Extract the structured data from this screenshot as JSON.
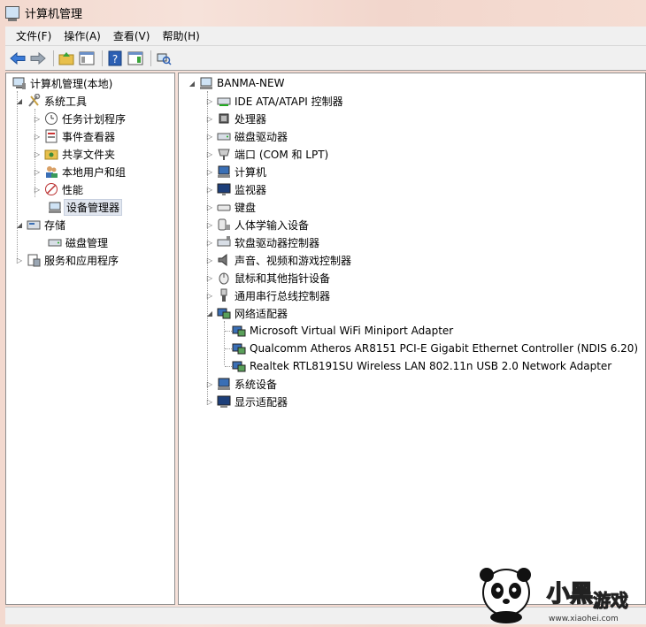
{
  "window": {
    "title": "计算机管理"
  },
  "menu": [
    {
      "label": "文件(F)"
    },
    {
      "label": "操作(A)"
    },
    {
      "label": "查看(V)"
    },
    {
      "label": "帮助(H)"
    }
  ],
  "toolbar": {
    "buttons": [
      "back-icon",
      "forward-icon",
      "up-folder-icon",
      "show-hide-tree-icon",
      "help-icon",
      "action-pane-icon",
      "scan-hardware-icon"
    ]
  },
  "left_tree": {
    "root": "计算机管理(本地)",
    "system_tools": "系统工具",
    "items": [
      "任务计划程序",
      "事件查看器",
      "共享文件夹",
      "本地用户和组",
      "性能",
      "设备管理器"
    ],
    "storage": "存储",
    "disk_management": "磁盘管理",
    "services": "服务和应用程序"
  },
  "right_tree": {
    "root": "BANMA-NEW",
    "categories": [
      "IDE ATA/ATAPI 控制器",
      "处理器",
      "磁盘驱动器",
      "端口 (COM 和 LPT)",
      "计算机",
      "监视器",
      "键盘",
      "人体学输入设备",
      "软盘驱动器控制器",
      "声音、视频和游戏控制器",
      "鼠标和其他指针设备",
      "通用串行总线控制器",
      "网络适配器"
    ],
    "network_adapters": [
      "Microsoft Virtual WiFi Miniport Adapter",
      "Qualcomm Atheros AR8151 PCI-E Gigabit Ethernet Controller (NDIS 6.20)",
      "Realtek RTL8191SU Wireless LAN 802.11n USB 2.0 Network Adapter"
    ],
    "after": [
      "系统设备",
      "显示适配器"
    ]
  },
  "watermark": {
    "text": "小黑游戏",
    "url": "www.xiaohei.com"
  },
  "colors": {
    "selected_bg": "#e1e6ef",
    "toolbar_bg": "#f0f0f0",
    "accent": "#1f5fbf"
  }
}
